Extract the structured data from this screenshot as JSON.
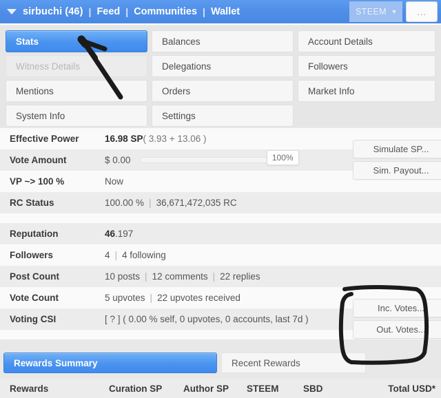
{
  "topbar": {
    "caret_icon": "caret-down-icon",
    "username": "sirbuchi (46)",
    "sep": "|",
    "links": [
      "Feed",
      "Communities",
      "Wallet"
    ],
    "chain_selector": "STEEM",
    "chain_caret_icon": "caret-down-icon",
    "overflow_label": "...",
    "bg_color": "#4f8ee8"
  },
  "tabs": {
    "col1": [
      {
        "label": "Stats",
        "state": "active"
      },
      {
        "label": "Witness Details",
        "state": "disabled"
      },
      {
        "label": "Mentions",
        "state": "normal"
      },
      {
        "label": "System Info",
        "state": "normal"
      }
    ],
    "col2": [
      {
        "label": "Balances",
        "state": "normal"
      },
      {
        "label": "Delegations",
        "state": "normal"
      },
      {
        "label": "Orders",
        "state": "normal"
      },
      {
        "label": "Settings",
        "state": "normal"
      }
    ],
    "col3": [
      {
        "label": "Account Details",
        "state": "normal"
      },
      {
        "label": "Followers",
        "state": "normal"
      },
      {
        "label": "Market Info",
        "state": "normal"
      },
      {
        "label": "",
        "state": "empty"
      }
    ],
    "active_color": "#4a93ef"
  },
  "stats": {
    "effective_power": {
      "label": "Effective Power",
      "value_bold": "16.98 SP",
      "value_rest": " ( 3.93 + 13.06 )"
    },
    "vote_amount": {
      "label": "Vote Amount",
      "value": "$ 0.00",
      "slider_percent": "100%"
    },
    "vp_100": {
      "label": "VP ~> 100 %",
      "value": "Now"
    },
    "rc_status": {
      "label": "RC Status",
      "percent": "100.00 %",
      "sep": "|",
      "rc": "36,671,472,035 RC"
    },
    "reputation": {
      "label": "Reputation",
      "value_bold": "46",
      "value_rest": ".197"
    },
    "followers": {
      "label": "Followers",
      "count": "4",
      "sep": "|",
      "following": "4 following"
    },
    "post_count": {
      "label": "Post Count",
      "posts": "10 posts",
      "sep1": "|",
      "comments": "12 comments",
      "sep2": "|",
      "replies": "22 replies"
    },
    "vote_count": {
      "label": "Vote Count",
      "upvotes": "5 upvotes",
      "sep": "|",
      "received": "22 upvotes received"
    },
    "voting_csi": {
      "label": "Voting CSI",
      "value": "[ ? ] ( 0.00 % self, 0 upvotes, 0 accounts, last 7d )"
    }
  },
  "side_buttons": {
    "simulate_sp": "Simulate SP...",
    "sim_payout": "Sim. Payout...",
    "inc_votes": "Inc. Votes...",
    "out_votes": "Out. Votes..."
  },
  "rewards": {
    "tabs": [
      {
        "label": "Rewards Summary",
        "state": "active"
      },
      {
        "label": "Recent Rewards",
        "state": "normal"
      }
    ],
    "columns": [
      "Rewards",
      "Curation SP",
      "Author SP",
      "STEEM",
      "SBD",
      "Total USD*"
    ]
  },
  "annotations": {
    "arrow": "hand-drawn-arrow-pointing-to-stats-tab",
    "circle": "hand-drawn-rectangle-around-votes-buttons",
    "ink_color": "#1a1a1a"
  }
}
